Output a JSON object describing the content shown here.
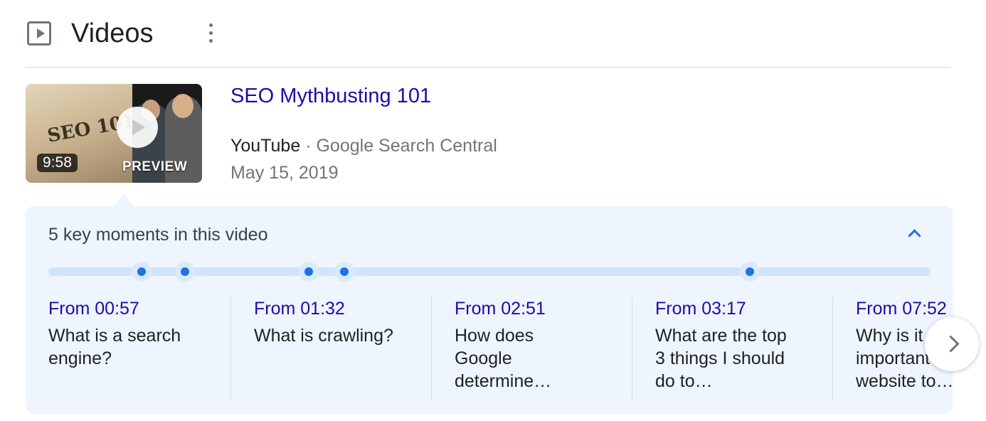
{
  "header": {
    "icon": "video-play-icon",
    "title": "Videos",
    "menu_icon": "more-vert-icon"
  },
  "video": {
    "title": "SEO Mythbusting 101",
    "thumbnail_text": "SEO 101",
    "duration": "9:58",
    "preview_label": "PREVIEW",
    "source": "YouTube",
    "separator": "·",
    "channel": "Google Search Central",
    "date": "May 15, 2019"
  },
  "key_moments": {
    "title": "5 key moments in this video",
    "collapse_icon": "chevron-up-icon",
    "items": [
      {
        "time": "From 00:57",
        "description": "What is a search engine?"
      },
      {
        "time": "From 01:32",
        "description": "What is crawling?"
      },
      {
        "time": "From 02:51",
        "description": "How does Google determine…"
      },
      {
        "time": "From 03:17",
        "description": "What are the top 3 things I should do to…"
      },
      {
        "time": "From 07:52",
        "description": "Why is it important to website to…"
      }
    ],
    "next_icon": "chevron-right-icon"
  },
  "colors": {
    "link": "#1a0dab",
    "accent": "#1a73e8",
    "panel_bg": "#eef5fe",
    "track": "#d2e3fc",
    "secondary_text": "#70757a"
  }
}
